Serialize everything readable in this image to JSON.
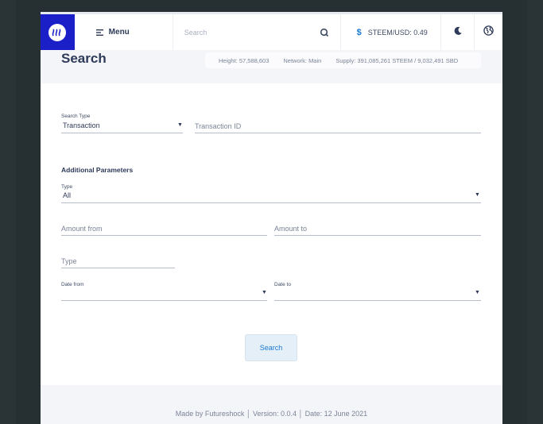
{
  "topbar": {
    "menu_label": "Menu",
    "search_placeholder": "Search",
    "price_text": "STEEM/USD: 0.49",
    "price_symbol": "$"
  },
  "header": {
    "title": "Search",
    "stats": {
      "height": "Height: 57,588,603",
      "network": "Network: Main",
      "supply": "Supply: 391,085,261 STEEM / 9,032,491 SBD"
    }
  },
  "form": {
    "search_type": {
      "label": "Search Type",
      "value": "Transaction"
    },
    "transaction_id": {
      "placeholder": "Transaction ID"
    },
    "additional_title": "Additional Parameters",
    "type_select": {
      "label": "Type",
      "value": "All"
    },
    "amount_from": {
      "placeholder": "Amount from"
    },
    "amount_to": {
      "placeholder": "Amount to"
    },
    "type_input": {
      "placeholder": "Type"
    },
    "date_from": {
      "label": "Date from"
    },
    "date_to": {
      "label": "Date to"
    },
    "search_button": "Search"
  },
  "footer": {
    "text": "Made by Futureshock │ Version: 0.0.4 │ Date: 12 June 2021"
  },
  "colors": {
    "brand": "#1a1fc8",
    "accent": "#1a7ad1",
    "text": "#2e3a59",
    "muted": "#7a8396"
  }
}
